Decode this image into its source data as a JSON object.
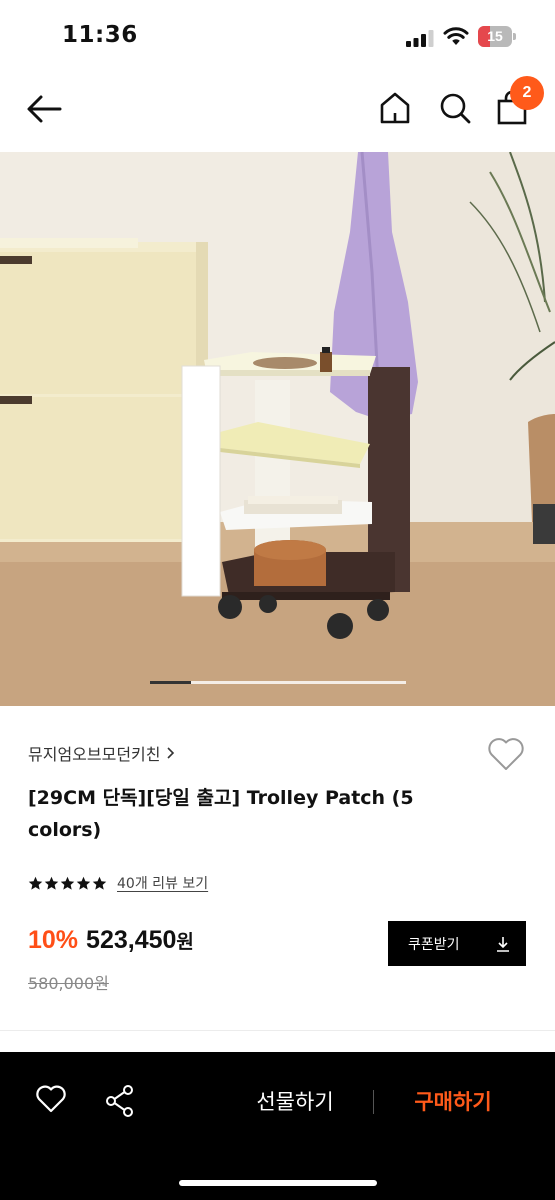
{
  "status_bar": {
    "time": "11:36",
    "battery_level": "15",
    "battery_color": "#e5484d"
  },
  "nav": {
    "icons": [
      "back-arrow-icon",
      "home-icon",
      "search-icon",
      "shopping-bag-icon"
    ],
    "cart_count": "2",
    "badge_color": "#ff5a1a"
  },
  "hero": {
    "carousel_position": 0.16
  },
  "product": {
    "brand": "뮤지엄오브모던키친",
    "title": "[29CM 단독][당일 출고] Trolley Patch (5 colors)",
    "rating": 5,
    "review_link": "40개 리뷰 보기",
    "discount": "10%",
    "price": "523,450",
    "price_unit": "원",
    "original_price": "580,000원",
    "coupon_label": "쿠폰받기",
    "accent_color": "#ff4f17"
  },
  "bottom_bar": {
    "gift_label": "선물하기",
    "buy_label": "구매하기",
    "icons": [
      "heart-icon",
      "share-icon"
    ]
  }
}
